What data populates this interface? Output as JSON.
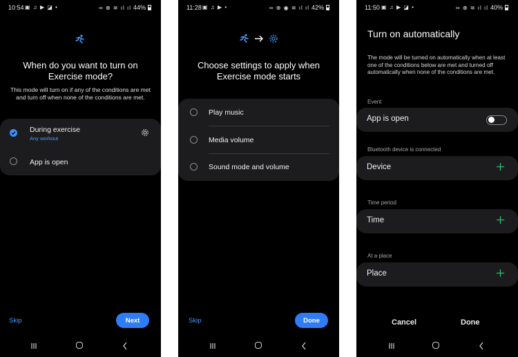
{
  "colors": {
    "accent": "#2f7df6",
    "link": "#4a9bff",
    "card": "#1c1c1e",
    "plus": "#26c46a",
    "background": "#000000"
  },
  "screens": [
    {
      "status": {
        "time": "10:54",
        "left_icons": "▣ ♫ ▶ ◪ •",
        "sys_icons": "∞ ⊕ ≋ ıl ıl",
        "battery": "44%"
      },
      "title": "When do you want to turn on Exercise mode?",
      "description": "This mode will turn on if any of the conditions are met and turn off when none of the conditions are met.",
      "options": [
        {
          "label": "During exercise",
          "sublabel": "Any workout",
          "checked": true,
          "icon": "gear-icon"
        },
        {
          "label": "App is open",
          "checked": false
        }
      ],
      "skip_label": "Skip",
      "primary_label": "Next"
    },
    {
      "status": {
        "time": "11:28",
        "left_icons": "▣ ♫ ▶ •",
        "sys_icons": "∞ ⊕ ◉ ≋ ıl ıl",
        "battery": "42%"
      },
      "title": "Choose settings to apply when Exercise mode starts",
      "options": [
        {
          "label": "Play music"
        },
        {
          "label": "Media volume"
        },
        {
          "label": "Sound mode and volume"
        }
      ],
      "skip_label": "Skip",
      "primary_label": "Done"
    },
    {
      "status": {
        "time": "11:50",
        "left_icons": "▣ ♫ ▶ ◪ •",
        "sys_icons": "∞ ⊕ ≋ ıl ıl",
        "battery": "40%"
      },
      "title": "Turn on automatically",
      "description": "The mode will be turned on automatically when at least one of the conditions below are met and turned off automatically when none of the conditions are met.",
      "sections": [
        {
          "header": "Event",
          "item": "App is open",
          "control": "toggle",
          "on": false
        },
        {
          "header": "Bluetooth device is connected",
          "item": "Device",
          "control": "plus"
        },
        {
          "header": "Time period",
          "item": "Time",
          "control": "plus"
        },
        {
          "header": "At a place",
          "item": "Place",
          "control": "plus"
        }
      ],
      "cancel_label": "Cancel",
      "done_label": "Done"
    }
  ]
}
